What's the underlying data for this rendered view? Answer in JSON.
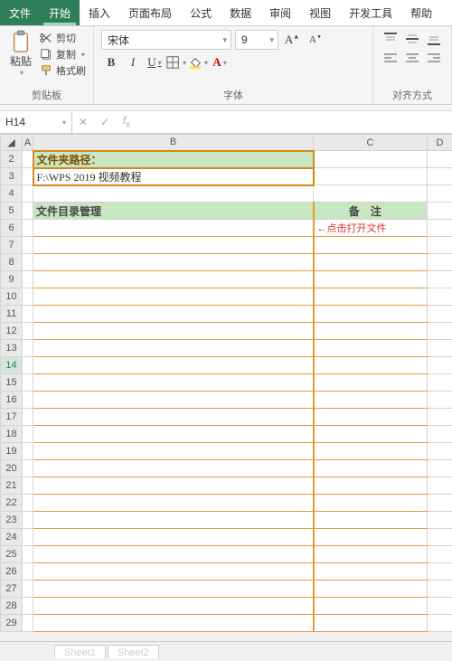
{
  "tabs": {
    "file": "文件",
    "home": "开始",
    "insert": "插入",
    "layout": "页面布局",
    "formula": "公式",
    "data": "数据",
    "review": "审阅",
    "view": "视图",
    "dev": "开发工具",
    "help": "帮助"
  },
  "ribbon": {
    "clipboard": {
      "paste": "粘贴",
      "cut": "剪切",
      "copy": "复制",
      "format_painter": "格式刷",
      "group_label": "剪贴板"
    },
    "font": {
      "name": "宋体",
      "size": "9",
      "group_label": "字体"
    },
    "alignment": {
      "group_label": "对齐方式"
    }
  },
  "name_box": "H14",
  "formula": "",
  "columns": [
    "A",
    "B",
    "C",
    "D"
  ],
  "active_row": 14,
  "sheet": {
    "path_label": "文件夹路径：",
    "path_value": "F:\\WPS 2019 视频教程",
    "list_header": "文件目录管理",
    "notes_header": "备注",
    "notes_hint": "←点击打开文件"
  },
  "row_count": 29,
  "sheet_tabs": [
    "Sheet1",
    "Sheet2"
  ]
}
